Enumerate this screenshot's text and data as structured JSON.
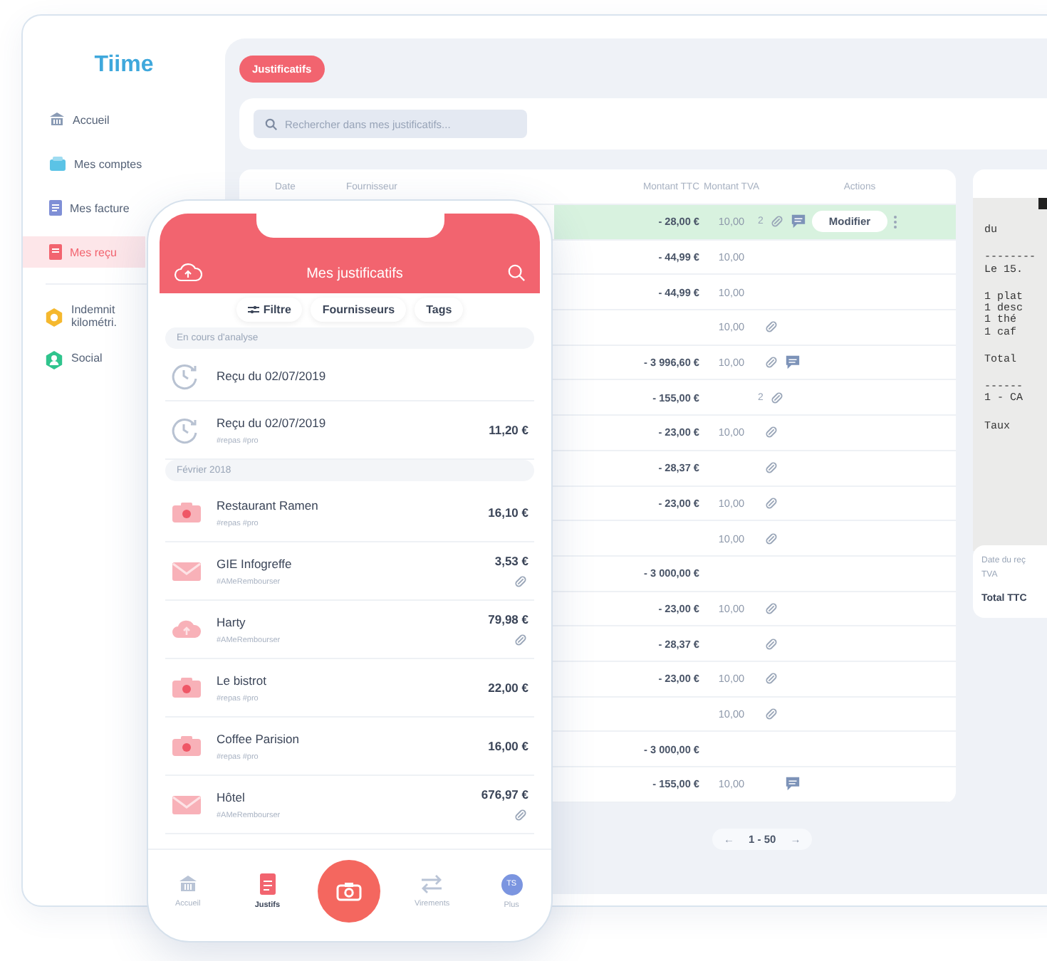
{
  "sidebar": {
    "logo": "Tiime",
    "items": [
      {
        "label": "Accueil",
        "selected": false
      },
      {
        "label": "Mes comptes",
        "selected": false
      },
      {
        "label": "Mes facture",
        "selected": false
      },
      {
        "label": "Mes reçu",
        "selected": true
      }
    ],
    "extra_items": [
      {
        "lines": [
          "Indemnit",
          "kilométri."
        ]
      },
      {
        "lines": [
          "Social"
        ]
      }
    ]
  },
  "main": {
    "tab": "Justificatifs",
    "search": {
      "placeholder": "Rechercher dans mes justificatifs..."
    },
    "table": {
      "columns": [
        "Date",
        "Fournisseur",
        "Montant TTC",
        "Montant TVA",
        "Actions"
      ],
      "rows": [
        {
          "ttc": "- 28,00 €",
          "tva": "10,00",
          "count": "2",
          "link": true,
          "comment": true,
          "button": "Modifier",
          "selected": true
        },
        {
          "ttc": "- 44,99 €",
          "tva": "10,00",
          "link": false,
          "comment": false,
          "selected": false
        },
        {
          "ttc": "- 44,99 €",
          "tva": "10,00",
          "link": false,
          "comment": false,
          "selected": false
        },
        {
          "tva": "10,00",
          "link": true,
          "comment": false,
          "selected": false
        },
        {
          "ttc": "- 3 996,60 €",
          "tva": "10,00",
          "link": true,
          "comment": true,
          "selected": false
        },
        {
          "ttc": "- 155,00 €",
          "count": "2",
          "link": true,
          "comment": false,
          "selected": false
        },
        {
          "ttc": "- 23,00 €",
          "tva": "10,00",
          "link": true,
          "comment": false,
          "selected": false
        },
        {
          "ttc": "- 28,37 €",
          "link": true,
          "comment": false,
          "selected": false
        },
        {
          "ttc": "- 23,00 €",
          "tva": "10,00",
          "link": true,
          "comment": false,
          "selected": false
        },
        {
          "tva": "10,00",
          "link": true,
          "comment": false,
          "selected": false
        },
        {
          "ttc": "- 3 000,00 €",
          "link": false,
          "comment": false,
          "selected": false
        },
        {
          "ttc": "- 23,00 €",
          "tva": "10,00",
          "link": true,
          "comment": false,
          "selected": false
        },
        {
          "ttc": "- 28,37 €",
          "link": true,
          "comment": false,
          "selected": false
        },
        {
          "ttc": "- 23,00 €",
          "tva": "10,00",
          "link": true,
          "comment": false,
          "selected": false
        },
        {
          "tva": "10,00",
          "link": true,
          "comment": false,
          "selected": false
        },
        {
          "ttc": "- 3 000,00 €",
          "link": false,
          "comment": false,
          "selected": false
        },
        {
          "ttc": "- 155,00 €",
          "tva": "10,00",
          "link": false,
          "comment": true,
          "selected": false
        }
      ]
    },
    "pagination": {
      "prev": "←",
      "range": "1 - 50",
      "next": "→"
    },
    "receipt": {
      "blocks": [
        [
          "du"
        ],
        [
          "--------",
          "Le 15."
        ],
        [
          "1 plat",
          "1 desc",
          "1 thé",
          "1 caf"
        ],
        [
          "Total"
        ],
        [
          "------",
          "1 - CA"
        ],
        [
          "Taux"
        ]
      ],
      "info": [
        "Date du reç",
        "TVA",
        "Total TTC"
      ]
    }
  },
  "phone": {
    "title": "Mes justificatifs",
    "chips": [
      "Filtre",
      "Fournisseurs",
      "Tags"
    ],
    "sections": [
      {
        "title": "En cours d'analyse",
        "items": [
          {
            "kind": "clock",
            "name": "Reçu du 02/07/2019",
            "link": false
          },
          {
            "kind": "clock",
            "name": "Reçu du 02/07/2019",
            "amount": "11,20 €",
            "tags": "#repas #pro",
            "link": false
          }
        ]
      },
      {
        "title": "Février 2018",
        "items": [
          {
            "kind": "camera",
            "name": "Restaurant Ramen",
            "amount": "16,10 €",
            "tags": "#repas #pro",
            "link": false
          },
          {
            "kind": "mail",
            "name": "GIE Infogreffe",
            "amount": "3,53 €",
            "tags": "#AMeRembourser",
            "link": true
          },
          {
            "kind": "cloud",
            "name": "Harty",
            "amount": "79,98 €",
            "tags": "#AMeRembourser",
            "link": true
          },
          {
            "kind": "camera",
            "name": "Le bistrot",
            "amount": "22,00 €",
            "tags": "#repas #pro",
            "link": false
          },
          {
            "kind": "camera",
            "name": "Coffee Parision",
            "amount": "16,00 €",
            "tags": "#repas #pro",
            "link": false
          },
          {
            "kind": "mail",
            "name": "Hôtel",
            "amount": "676,97 €",
            "tags": "#AMeRembourser",
            "link": true
          }
        ]
      }
    ],
    "nav": [
      {
        "kind": "home",
        "label": "Accueil",
        "selected": false
      },
      {
        "kind": "doc",
        "label": "Justifs",
        "selected": true
      },
      {
        "kind": "camera"
      },
      {
        "kind": "transfer",
        "label": "Virements",
        "selected": false
      },
      {
        "kind": "avatar",
        "label": "Plus",
        "initials": "TS",
        "selected": false
      }
    ]
  }
}
